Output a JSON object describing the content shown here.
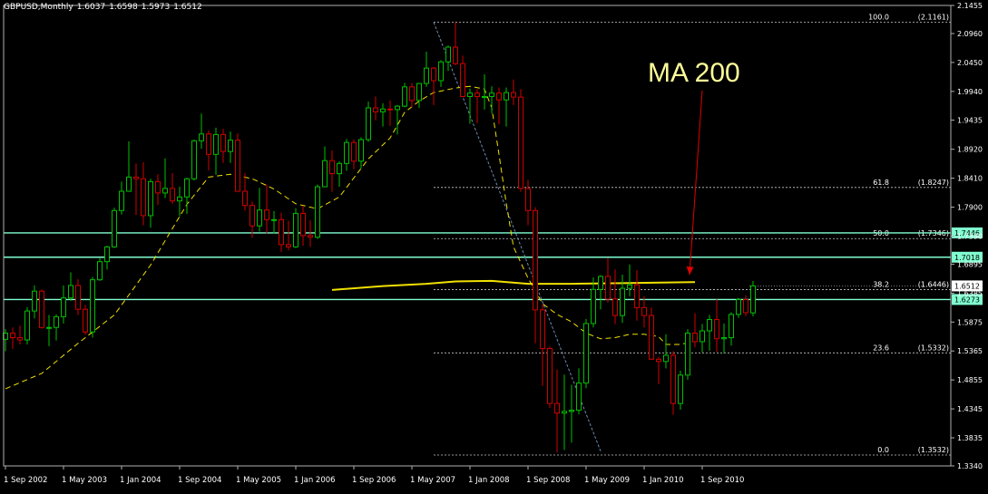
{
  "header": {
    "symbol": "GBPUSD,Monthly",
    "open": "1.6037",
    "high": "1.6598",
    "low": "1.5973",
    "close": "1.6512"
  },
  "annotation": {
    "label": "MA 200"
  },
  "colors": {
    "background": "#000000",
    "bull": "#00c000",
    "bear": "#d00000",
    "ma_dashed": "#f0e000",
    "ma_200": "#f0e000",
    "level_lines": "#80ffd0",
    "fibo": "#c8c8c8",
    "trend": "#6a8ab0",
    "arrow": "#e00000",
    "axis_text": "#ffffff"
  },
  "chart_data": {
    "type": "candlestick",
    "title": "GBPUSD,Monthly",
    "ylim": [
      1.334,
      2.1455
    ],
    "y_ticks": [
      "2.1455",
      "2.0960",
      "2.0450",
      "1.9940",
      "1.9435",
      "1.8920",
      "1.8410",
      "1.7900",
      "1.7390",
      "1.6895",
      "1.6385",
      "1.5875",
      "1.5365",
      "1.4855",
      "1.4345",
      "1.3835",
      "1.3340"
    ],
    "x_labels": [
      "1 Sep 2002",
      "1 May 2003",
      "1 Jan 2004",
      "1 Sep 2004",
      "1 May 2005",
      "1 Jan 2006",
      "1 Sep 2006",
      "1 May 2007",
      "1 Jan 2008",
      "1 Sep 2008",
      "1 May 2009",
      "1 Jan 2010",
      "1 Sep 2010"
    ],
    "candles": [
      {
        "date": "2002-09",
        "o": 1.557,
        "h": 1.575,
        "l": 1.536,
        "c": 1.568
      },
      {
        "date": "2002-10",
        "o": 1.568,
        "h": 1.578,
        "l": 1.54,
        "c": 1.56
      },
      {
        "date": "2002-11",
        "o": 1.56,
        "h": 1.581,
        "l": 1.548,
        "c": 1.556
      },
      {
        "date": "2002-12",
        "o": 1.556,
        "h": 1.614,
        "l": 1.548,
        "c": 1.607
      },
      {
        "date": "2003-01",
        "o": 1.607,
        "h": 1.652,
        "l": 1.594,
        "c": 1.642
      },
      {
        "date": "2003-02",
        "o": 1.642,
        "h": 1.645,
        "l": 1.576,
        "c": 1.578
      },
      {
        "date": "2003-03",
        "o": 1.578,
        "h": 1.6,
        "l": 1.545,
        "c": 1.578
      },
      {
        "date": "2003-04",
        "o": 1.578,
        "h": 1.601,
        "l": 1.555,
        "c": 1.597
      },
      {
        "date": "2003-05",
        "o": 1.597,
        "h": 1.652,
        "l": 1.585,
        "c": 1.63
      },
      {
        "date": "2003-06",
        "o": 1.63,
        "h": 1.675,
        "l": 1.625,
        "c": 1.652
      },
      {
        "date": "2003-07",
        "o": 1.652,
        "h": 1.663,
        "l": 1.6,
        "c": 1.61
      },
      {
        "date": "2003-08",
        "o": 1.61,
        "h": 1.618,
        "l": 1.565,
        "c": 1.57
      },
      {
        "date": "2003-09",
        "o": 1.57,
        "h": 1.667,
        "l": 1.56,
        "c": 1.662
      },
      {
        "date": "2003-10",
        "o": 1.662,
        "h": 1.7,
        "l": 1.66,
        "c": 1.694
      },
      {
        "date": "2003-11",
        "o": 1.694,
        "h": 1.722,
        "l": 1.68,
        "c": 1.72
      },
      {
        "date": "2003-12",
        "o": 1.72,
        "h": 1.789,
        "l": 1.718,
        "c": 1.784
      },
      {
        "date": "2004-01",
        "o": 1.784,
        "h": 1.835,
        "l": 1.777,
        "c": 1.818
      },
      {
        "date": "2004-02",
        "o": 1.818,
        "h": 1.906,
        "l": 1.817,
        "c": 1.843
      },
      {
        "date": "2004-03",
        "o": 1.843,
        "h": 1.867,
        "l": 1.776,
        "c": 1.84
      },
      {
        "date": "2004-04",
        "o": 1.84,
        "h": 1.869,
        "l": 1.758,
        "c": 1.775
      },
      {
        "date": "2004-05",
        "o": 1.775,
        "h": 1.84,
        "l": 1.754,
        "c": 1.835
      },
      {
        "date": "2004-06",
        "o": 1.835,
        "h": 1.848,
        "l": 1.794,
        "c": 1.815
      },
      {
        "date": "2004-07",
        "o": 1.815,
        "h": 1.876,
        "l": 1.806,
        "c": 1.823
      },
      {
        "date": "2004-08",
        "o": 1.823,
        "h": 1.85,
        "l": 1.796,
        "c": 1.801
      },
      {
        "date": "2004-09",
        "o": 1.801,
        "h": 1.826,
        "l": 1.774,
        "c": 1.808
      },
      {
        "date": "2004-10",
        "o": 1.808,
        "h": 1.842,
        "l": 1.778,
        "c": 1.84
      },
      {
        "date": "2004-11",
        "o": 1.84,
        "h": 1.909,
        "l": 1.837,
        "c": 1.907
      },
      {
        "date": "2004-12",
        "o": 1.907,
        "h": 1.955,
        "l": 1.893,
        "c": 1.919
      },
      {
        "date": "2005-01",
        "o": 1.919,
        "h": 1.925,
        "l": 1.855,
        "c": 1.883
      },
      {
        "date": "2005-02",
        "o": 1.883,
        "h": 1.93,
        "l": 1.847,
        "c": 1.918
      },
      {
        "date": "2005-03",
        "o": 1.918,
        "h": 1.928,
        "l": 1.868,
        "c": 1.888
      },
      {
        "date": "2005-04",
        "o": 1.888,
        "h": 1.923,
        "l": 1.868,
        "c": 1.908
      },
      {
        "date": "2005-05",
        "o": 1.908,
        "h": 1.92,
        "l": 1.817,
        "c": 1.818
      },
      {
        "date": "2005-06",
        "o": 1.818,
        "h": 1.85,
        "l": 1.784,
        "c": 1.793
      },
      {
        "date": "2005-07",
        "o": 1.793,
        "h": 1.8,
        "l": 1.736,
        "c": 1.757
      },
      {
        "date": "2005-08",
        "o": 1.757,
        "h": 1.824,
        "l": 1.747,
        "c": 1.785
      },
      {
        "date": "2005-09",
        "o": 1.785,
        "h": 1.83,
        "l": 1.744,
        "c": 1.768
      },
      {
        "date": "2005-10",
        "o": 1.768,
        "h": 1.783,
        "l": 1.744,
        "c": 1.768
      },
      {
        "date": "2005-11",
        "o": 1.768,
        "h": 1.78,
        "l": 1.711,
        "c": 1.724
      },
      {
        "date": "2005-12",
        "o": 1.724,
        "h": 1.766,
        "l": 1.714,
        "c": 1.72
      },
      {
        "date": "2006-01",
        "o": 1.72,
        "h": 1.788,
        "l": 1.718,
        "c": 1.779
      },
      {
        "date": "2006-02",
        "o": 1.779,
        "h": 1.792,
        "l": 1.722,
        "c": 1.74
      },
      {
        "date": "2006-03",
        "o": 1.74,
        "h": 1.767,
        "l": 1.72,
        "c": 1.737
      },
      {
        "date": "2006-04",
        "o": 1.737,
        "h": 1.83,
        "l": 1.734,
        "c": 1.826
      },
      {
        "date": "2006-05",
        "o": 1.826,
        "h": 1.897,
        "l": 1.825,
        "c": 1.872
      },
      {
        "date": "2006-06",
        "o": 1.872,
        "h": 1.89,
        "l": 1.817,
        "c": 1.849
      },
      {
        "date": "2006-07",
        "o": 1.849,
        "h": 1.871,
        "l": 1.826,
        "c": 1.867
      },
      {
        "date": "2006-08",
        "o": 1.867,
        "h": 1.91,
        "l": 1.854,
        "c": 1.904
      },
      {
        "date": "2006-09",
        "o": 1.904,
        "h": 1.909,
        "l": 1.857,
        "c": 1.871
      },
      {
        "date": "2006-10",
        "o": 1.871,
        "h": 1.913,
        "l": 1.858,
        "c": 1.909
      },
      {
        "date": "2006-11",
        "o": 1.909,
        "h": 1.976,
        "l": 1.905,
        "c": 1.965
      },
      {
        "date": "2006-12",
        "o": 1.965,
        "h": 1.985,
        "l": 1.943,
        "c": 1.958
      },
      {
        "date": "2007-01",
        "o": 1.958,
        "h": 1.973,
        "l": 1.932,
        "c": 1.963
      },
      {
        "date": "2007-02",
        "o": 1.963,
        "h": 1.978,
        "l": 1.933,
        "c": 1.962
      },
      {
        "date": "2007-03",
        "o": 1.962,
        "h": 1.97,
        "l": 1.918,
        "c": 1.968
      },
      {
        "date": "2007-04",
        "o": 1.968,
        "h": 2.009,
        "l": 1.966,
        "c": 2.002
      },
      {
        "date": "2007-05",
        "o": 2.002,
        "h": 2.009,
        "l": 1.966,
        "c": 1.978
      },
      {
        "date": "2007-06",
        "o": 1.978,
        "h": 2.009,
        "l": 1.965,
        "c": 2.008
      },
      {
        "date": "2007-07",
        "o": 2.008,
        "h": 2.064,
        "l": 2.002,
        "c": 2.035
      },
      {
        "date": "2007-08",
        "o": 2.035,
        "h": 2.037,
        "l": 1.97,
        "c": 2.013
      },
      {
        "date": "2007-09",
        "o": 2.013,
        "h": 2.049,
        "l": 2.002,
        "c": 2.046
      },
      {
        "date": "2007-10",
        "o": 2.046,
        "h": 2.075,
        "l": 2.03,
        "c": 2.072
      },
      {
        "date": "2007-11",
        "o": 2.072,
        "h": 2.116,
        "l": 2.04,
        "c": 2.043
      },
      {
        "date": "2007-12",
        "o": 2.043,
        "h": 2.057,
        "l": 1.984,
        "c": 1.985
      },
      {
        "date": "2008-01",
        "o": 1.985,
        "h": 1.999,
        "l": 1.937,
        "c": 1.991
      },
      {
        "date": "2008-02",
        "o": 1.991,
        "h": 1.998,
        "l": 1.938,
        "c": 1.985
      },
      {
        "date": "2008-03",
        "o": 1.985,
        "h": 2.024,
        "l": 1.962,
        "c": 1.985
      },
      {
        "date": "2008-04",
        "o": 1.985,
        "h": 2.003,
        "l": 1.955,
        "c": 1.991
      },
      {
        "date": "2008-05",
        "o": 1.991,
        "h": 2.001,
        "l": 1.936,
        "c": 1.979
      },
      {
        "date": "2008-06",
        "o": 1.979,
        "h": 2.001,
        "l": 1.932,
        "c": 1.992
      },
      {
        "date": "2008-07",
        "o": 1.992,
        "h": 2.015,
        "l": 1.97,
        "c": 1.984
      },
      {
        "date": "2008-08",
        "o": 1.984,
        "h": 1.998,
        "l": 1.817,
        "c": 1.823
      },
      {
        "date": "2008-09",
        "o": 1.823,
        "h": 1.838,
        "l": 1.758,
        "c": 1.784
      },
      {
        "date": "2008-10",
        "o": 1.784,
        "h": 1.79,
        "l": 1.55,
        "c": 1.609
      },
      {
        "date": "2008-11",
        "o": 1.609,
        "h": 1.619,
        "l": 1.475,
        "c": 1.541
      },
      {
        "date": "2008-12",
        "o": 1.541,
        "h": 1.544,
        "l": 1.436,
        "c": 1.444
      },
      {
        "date": "2009-01",
        "o": 1.444,
        "h": 1.504,
        "l": 1.358,
        "c": 1.427
      },
      {
        "date": "2009-02",
        "o": 1.427,
        "h": 1.495,
        "l": 1.362,
        "c": 1.43
      },
      {
        "date": "2009-03",
        "o": 1.43,
        "h": 1.477,
        "l": 1.375,
        "c": 1.432
      },
      {
        "date": "2009-04",
        "o": 1.432,
        "h": 1.506,
        "l": 1.425,
        "c": 1.48
      },
      {
        "date": "2009-05",
        "o": 1.48,
        "h": 1.593,
        "l": 1.471,
        "c": 1.585
      },
      {
        "date": "2009-06",
        "o": 1.585,
        "h": 1.666,
        "l": 1.578,
        "c": 1.645
      },
      {
        "date": "2009-07",
        "o": 1.645,
        "h": 1.67,
        "l": 1.61,
        "c": 1.668
      },
      {
        "date": "2009-08",
        "o": 1.668,
        "h": 1.7,
        "l": 1.622,
        "c": 1.628
      },
      {
        "date": "2009-09",
        "o": 1.628,
        "h": 1.68,
        "l": 1.584,
        "c": 1.599
      },
      {
        "date": "2009-10",
        "o": 1.599,
        "h": 1.671,
        "l": 1.586,
        "c": 1.647
      },
      {
        "date": "2009-11",
        "o": 1.647,
        "h": 1.689,
        "l": 1.633,
        "c": 1.653
      },
      {
        "date": "2009-12",
        "o": 1.653,
        "h": 1.679,
        "l": 1.59,
        "c": 1.613
      },
      {
        "date": "2010-01",
        "o": 1.613,
        "h": 1.633,
        "l": 1.578,
        "c": 1.599
      },
      {
        "date": "2010-02",
        "o": 1.599,
        "h": 1.613,
        "l": 1.522,
        "c": 1.522
      },
      {
        "date": "2010-03",
        "o": 1.522,
        "h": 1.526,
        "l": 1.478,
        "c": 1.518
      },
      {
        "date": "2010-04",
        "o": 1.518,
        "h": 1.566,
        "l": 1.506,
        "c": 1.529
      },
      {
        "date": "2010-05",
        "o": 1.529,
        "h": 1.536,
        "l": 1.424,
        "c": 1.444
      },
      {
        "date": "2010-06",
        "o": 1.444,
        "h": 1.502,
        "l": 1.433,
        "c": 1.494
      },
      {
        "date": "2010-07",
        "o": 1.494,
        "h": 1.575,
        "l": 1.486,
        "c": 1.568
      },
      {
        "date": "2010-08",
        "o": 1.568,
        "h": 1.603,
        "l": 1.543,
        "c": 1.553
      },
      {
        "date": "2010-09",
        "o": 1.553,
        "h": 1.584,
        "l": 1.534,
        "c": 1.572
      },
      {
        "date": "2010-10",
        "o": 1.572,
        "h": 1.6,
        "l": 1.537,
        "c": 1.592
      },
      {
        "date": "2010-11",
        "o": 1.592,
        "h": 1.628,
        "l": 1.535,
        "c": 1.558
      },
      {
        "date": "2010-12",
        "o": 1.558,
        "h": 1.585,
        "l": 1.532,
        "c": 1.56
      },
      {
        "date": "2011-01",
        "o": 1.56,
        "h": 1.605,
        "l": 1.546,
        "c": 1.601
      },
      {
        "date": "2011-02",
        "o": 1.601,
        "h": 1.63,
        "l": 1.595,
        "c": 1.627
      },
      {
        "date": "2011-03",
        "o": 1.627,
        "h": 1.635,
        "l": 1.598,
        "c": 1.604
      },
      {
        "date": "2011-04",
        "o": 1.6037,
        "h": 1.6598,
        "l": 1.5973,
        "c": 1.6512
      }
    ],
    "ma_dashed": [
      [
        0,
        1.47
      ],
      [
        5,
        1.497
      ],
      [
        10,
        1.55
      ],
      [
        15,
        1.6
      ],
      [
        20,
        1.688
      ],
      [
        25,
        1.795
      ],
      [
        28,
        1.843
      ],
      [
        31,
        1.848
      ],
      [
        34,
        1.84
      ],
      [
        37,
        1.822
      ],
      [
        40,
        1.796
      ],
      [
        43,
        1.787
      ],
      [
        46,
        1.808
      ],
      [
        50,
        1.875
      ],
      [
        53,
        1.912
      ],
      [
        55,
        1.957
      ],
      [
        57,
        1.977
      ],
      [
        59,
        1.992
      ],
      [
        62,
        2.0
      ],
      [
        64,
        2.003
      ],
      [
        66,
        1.998
      ],
      [
        67,
        1.965
      ],
      [
        68,
        1.883
      ],
      [
        69,
        1.797
      ],
      [
        70,
        1.72
      ],
      [
        72,
        1.665
      ],
      [
        74,
        1.62
      ],
      [
        76,
        1.601
      ],
      [
        78,
        1.588
      ],
      [
        80,
        1.568
      ],
      [
        82,
        1.558
      ],
      [
        84,
        1.56
      ],
      [
        86,
        1.566
      ],
      [
        88,
        1.566
      ],
      [
        90,
        1.562
      ],
      [
        91,
        1.548
      ],
      [
        93,
        1.548
      ],
      [
        95,
        1.554
      ]
    ],
    "ma_200": [
      [
        45,
        1.644
      ],
      [
        52,
        1.651
      ],
      [
        58,
        1.655
      ],
      [
        62,
        1.659
      ],
      [
        67,
        1.66
      ],
      [
        72,
        1.655
      ],
      [
        78,
        1.655
      ],
      [
        85,
        1.656
      ],
      [
        95,
        1.658
      ]
    ],
    "fibonacci": {
      "high": 2.1161,
      "low": 1.3532,
      "start_index": 59,
      "levels": [
        {
          "label": "100.0",
          "value": "(2.1161)",
          "price": 2.1161
        },
        {
          "label": "61.8",
          "value": "(1.8247)",
          "price": 1.8247
        },
        {
          "label": "50.0",
          "value": "(1.7346)",
          "price": 1.7346
        },
        {
          "label": "38.2",
          "value": "(1.6446)",
          "price": 1.6446
        },
        {
          "label": "23.6",
          "value": "(1.5332)",
          "price": 1.5332
        },
        {
          "label": "0.0",
          "value": "(1.3532)",
          "price": 1.3532
        }
      ]
    },
    "trendline": {
      "from": [
        59,
        2.116
      ],
      "to": [
        82,
        1.36
      ]
    },
    "horizontal_levels": [
      {
        "price": 1.7446,
        "label": "1.7446"
      },
      {
        "price": 1.7018,
        "label": "1.7018"
      },
      {
        "price": 1.6273,
        "label": "1.6273"
      }
    ],
    "current_price": {
      "price": 1.6512,
      "label": "1.6512"
    },
    "annotation_arrow": {
      "text": "MA 200",
      "target_index": 94,
      "target_price": 1.661
    }
  }
}
